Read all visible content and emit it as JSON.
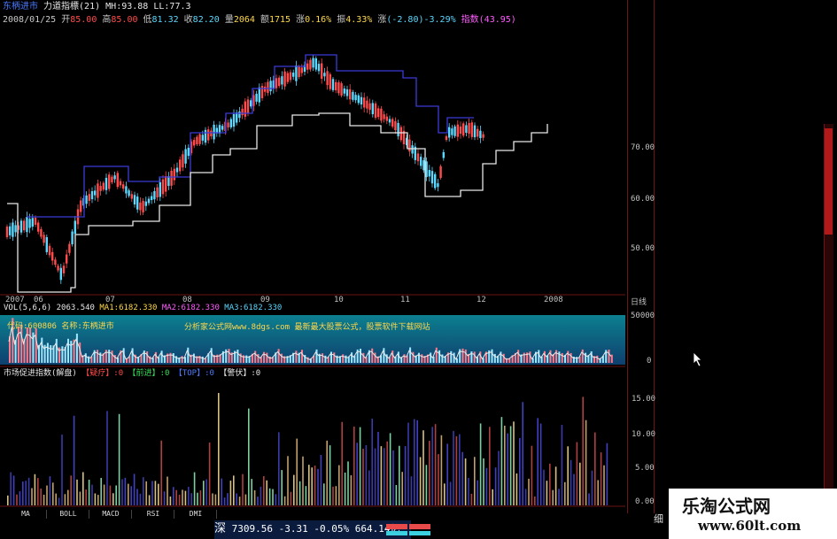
{
  "info": {
    "stock_name": "东柄进市",
    "indicator": "力道指標(21)",
    "mh_label": "MH:",
    "mh_value": "93.88",
    "ll_label": "LL:",
    "ll_value": "77.3",
    "date": "2008/01/25",
    "open_label": "开",
    "open_value": "85.00",
    "high_label": "高",
    "high_value": "85.00",
    "low_label": "低",
    "low_value": "81.32",
    "close_label": "收",
    "close_value": "82.20",
    "volume_label": "量",
    "volume_value": "2064",
    "amount_label": "额",
    "amount_value": "1715",
    "change_label": "涨",
    "change_value": "0.16%",
    "turnover_label": "振",
    "turnover_value": "4.33%",
    "pct_label": "涨",
    "pct_value": "(-2.80)-3.29%",
    "index_label": "指数",
    "index_value": "(43.95)"
  },
  "price_axis": {
    "labels": [
      "70.00",
      "60.00",
      "50.00"
    ],
    "corner": "日线"
  },
  "time_axis": {
    "labels": [
      "2007",
      "06",
      "07",
      "08",
      "09",
      "10",
      "11",
      "12",
      "2008"
    ]
  },
  "volume_panel": {
    "header_prefix": "VOL(5,6,6)",
    "header_value": "2063.540",
    "ma1": "MA1:6182.330",
    "ma2": "MA2:6182.330",
    "ma3": "MA3:6182.330",
    "name_line": "代码:600806 名称:东柄进市",
    "watermark": "分析家公式网www.8dgs.com 最新最大股票公式，股票软件下载网站",
    "axis_labels": [
      "50000",
      "0"
    ]
  },
  "indicator_panel": {
    "title": "市场促进指数(解盘)",
    "items": [
      {
        "label": "【疑疗】",
        "value": ":0"
      },
      {
        "label": "【前进】",
        "value": ":0"
      },
      {
        "label": "【TOP】",
        "value": ":0"
      },
      {
        "label": "【警伏】",
        "value": ":0"
      }
    ],
    "axis_labels": [
      "15.00",
      "10.00",
      "5.00",
      "0.00"
    ]
  },
  "bottom_tabs": [
    "MA",
    "BOLL",
    "MACD",
    "RSI",
    "DMI"
  ],
  "status": {
    "market": "深",
    "index": "7309.56",
    "change": "-3.31",
    "pct": "-0.05%",
    "turnover": "664.14亿"
  },
  "corner_label": "细",
  "brand": {
    "name": "乐淘公式网",
    "url": "www.60lt.com"
  },
  "colors": {
    "up": "#ff4b4b",
    "down": "#5ad8ff",
    "background": "#000000",
    "panel_border": "#6e1414"
  }
}
